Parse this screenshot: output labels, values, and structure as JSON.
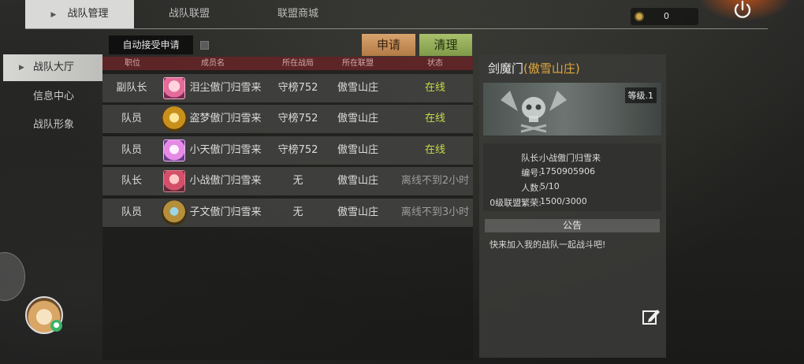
{
  "top_tabs": [
    {
      "label": "战队管理",
      "active": true
    },
    {
      "label": "战队联盟",
      "active": false
    },
    {
      "label": "联盟商城",
      "active": false
    }
  ],
  "currency": {
    "icon": "coin-icon",
    "value": "0"
  },
  "sidebar": {
    "items": [
      {
        "label": "战队大厅",
        "active": true
      },
      {
        "label": "信息中心",
        "active": false
      },
      {
        "label": "战队形象",
        "active": false
      }
    ]
  },
  "controls": {
    "auto_accept_label": "自动接受申请",
    "auto_accept_checked": false,
    "apply_label": "申请",
    "clear_label": "清理"
  },
  "table": {
    "headers": [
      "职位",
      "成员名",
      "所在战局",
      "所在联盟",
      "状态"
    ],
    "rows": [
      {
        "position": "副队长",
        "avatar": "pink-hair-girl-avatar",
        "name": "泪尘傲门归雪来",
        "server": "守榜752",
        "alliance": "傲雪山庄",
        "status": "在线",
        "online": true
      },
      {
        "position": "队员",
        "avatar": "gold-emblem-avatar",
        "name": "盗梦傲门归雪来",
        "server": "守榜752",
        "alliance": "傲雪山庄",
        "status": "在线",
        "online": true
      },
      {
        "position": "队员",
        "avatar": "pink-girl-avatar",
        "name": "小天傲门归雪来",
        "server": "守榜752",
        "alliance": "傲雪山庄",
        "status": "在线",
        "online": true
      },
      {
        "position": "队长",
        "avatar": "boy-avatar",
        "name": "小战傲门归雪来",
        "server": "无",
        "alliance": "傲雪山庄",
        "status": "离线不到2小时",
        "online": false
      },
      {
        "position": "队员",
        "avatar": "badge-emblem-avatar",
        "name": "子文傲门归雪来",
        "server": "无",
        "alliance": "傲雪山庄",
        "status": "离线不到3小时",
        "online": false
      }
    ]
  },
  "guild": {
    "name": "剑魔门",
    "alliance": "(傲雪山庄)",
    "level": "等级.1",
    "info": [
      {
        "key": "队长:",
        "value": "小战傲门归雪来"
      },
      {
        "key": "编号:",
        "value": "1750905906"
      },
      {
        "key": "人数:",
        "value": "5/10"
      },
      {
        "key": "0级联盟繁荣:",
        "value": "1500/3000"
      }
    ],
    "notice_title": "公告",
    "notice_text": "快来加入我的战队一起战斗吧!"
  },
  "colors": {
    "online": "#c9d94a",
    "offline": "#9c9c9c",
    "header_bar": "#5e2526",
    "apply_button": "#c8915a",
    "clear_button": "#94ad58",
    "alliance_accent": "#e0a83a"
  }
}
